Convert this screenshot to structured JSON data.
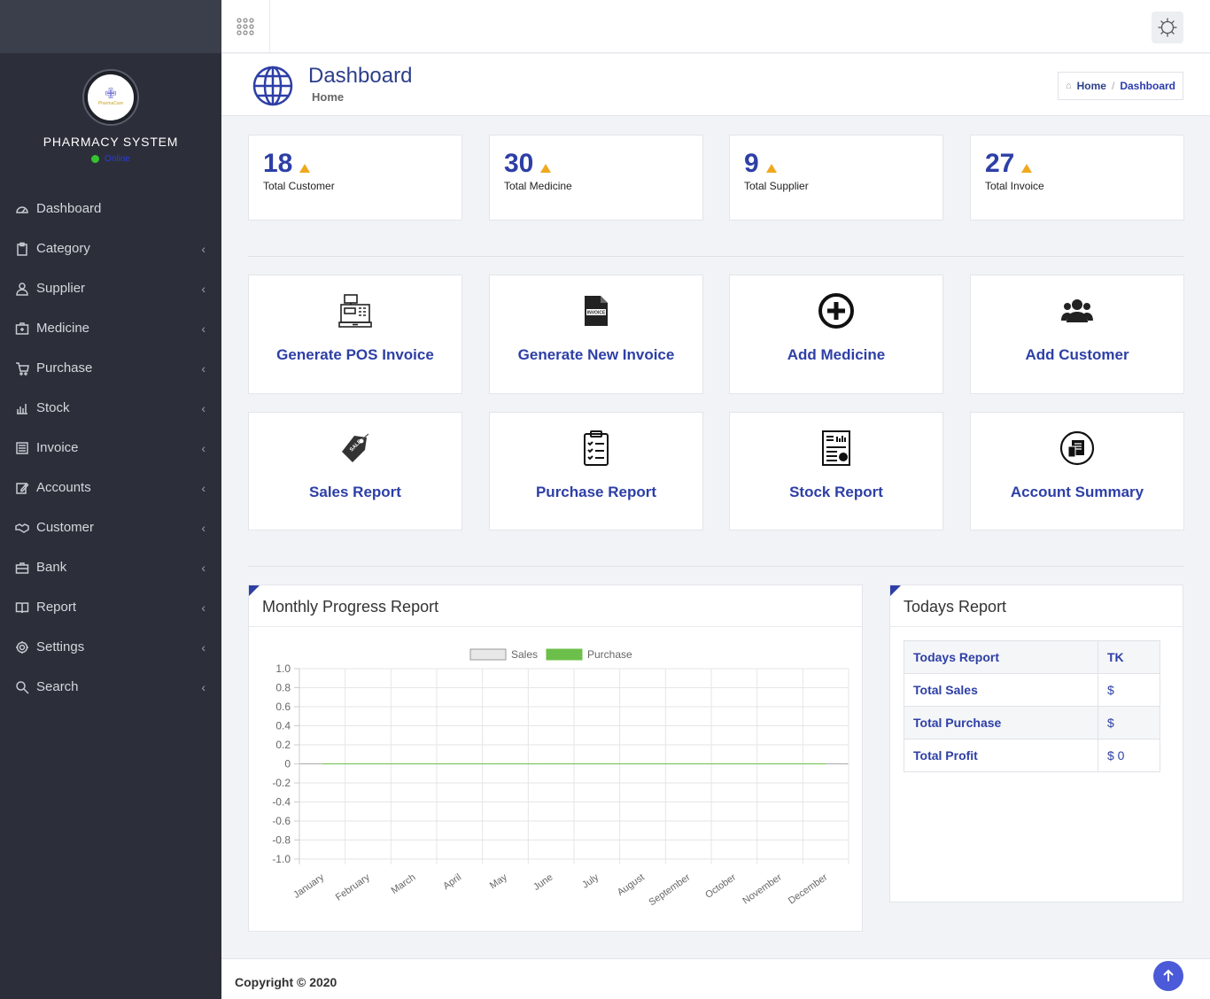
{
  "sidebar": {
    "system_name": "PHARMACY SYSTEM",
    "status": "Online",
    "logo_text": "PharmaCare",
    "items": [
      {
        "label": "Dashboard",
        "icon": "dashboard-icon",
        "chevron": ""
      },
      {
        "label": "Category",
        "icon": "clipboard-icon",
        "chevron": "‹"
      },
      {
        "label": "Supplier",
        "icon": "user-icon",
        "chevron": "‹"
      },
      {
        "label": "Medicine",
        "icon": "medkit-icon",
        "chevron": "‹"
      },
      {
        "label": "Purchase",
        "icon": "cart-icon",
        "chevron": "‹"
      },
      {
        "label": "Stock",
        "icon": "bar-chart-icon",
        "chevron": "‹"
      },
      {
        "label": "Invoice",
        "icon": "list-icon",
        "chevron": "‹"
      },
      {
        "label": "Accounts",
        "icon": "edit-icon",
        "chevron": "‹"
      },
      {
        "label": "Customer",
        "icon": "handshake-icon",
        "chevron": "‹"
      },
      {
        "label": "Bank",
        "icon": "briefcase-icon",
        "chevron": "‹"
      },
      {
        "label": "Report",
        "icon": "book-icon",
        "chevron": "‹"
      },
      {
        "label": "Settings",
        "icon": "gear-icon",
        "chevron": "‹"
      },
      {
        "label": "Search",
        "icon": "search-icon",
        "chevron": "‹"
      }
    ]
  },
  "header": {
    "title": "Dashboard",
    "subtitle": "Home",
    "breadcrumb": {
      "home": "Home",
      "separator": "/",
      "current": "Dashboard"
    }
  },
  "stats": [
    {
      "value": "18",
      "label": "Total Customer"
    },
    {
      "value": "30",
      "label": "Total Medicine"
    },
    {
      "value": "9",
      "label": "Total Supplier"
    },
    {
      "value": "27",
      "label": "Total Invoice"
    }
  ],
  "actions": [
    {
      "label": "Generate POS Invoice",
      "icon": "cash-register-icon"
    },
    {
      "label": "Generate New Invoice",
      "icon": "invoice-file-icon"
    },
    {
      "label": "Add Medicine",
      "icon": "plus-circle-icon"
    },
    {
      "label": "Add Customer",
      "icon": "users-icon"
    },
    {
      "label": "Sales Report",
      "icon": "sale-tag-icon"
    },
    {
      "label": "Purchase Report",
      "icon": "clipboard-list-icon"
    },
    {
      "label": "Stock Report",
      "icon": "stock-report-icon"
    },
    {
      "label": "Account Summary",
      "icon": "account-summary-icon"
    }
  ],
  "monthly_panel": {
    "title": "Monthly Progress Report"
  },
  "chart_data": {
    "type": "line",
    "title": "",
    "xlabel": "",
    "ylabel": "",
    "categories": [
      "January",
      "February",
      "March",
      "April",
      "May",
      "June",
      "July",
      "August",
      "September",
      "October",
      "November",
      "December"
    ],
    "series": [
      {
        "name": "Sales",
        "values": [
          0,
          0,
          0,
          0,
          0,
          0,
          0,
          0,
          0,
          0,
          0,
          0
        ],
        "color": "#e8e8e8"
      },
      {
        "name": "Purchase",
        "values": [
          0,
          0,
          0,
          0,
          0,
          0,
          0,
          0,
          0,
          0,
          0,
          0
        ],
        "color": "#6cbf4a"
      }
    ],
    "ylim": [
      -1.0,
      1.0
    ],
    "yticks": [
      "1.0",
      "0.8",
      "0.6",
      "0.4",
      "0.2",
      "0",
      "-0.2",
      "-0.4",
      "-0.6",
      "-0.8",
      "-1.0"
    ],
    "grid": true,
    "legend": "top"
  },
  "todays_panel": {
    "title": "Todays Report",
    "rows": [
      {
        "label": "Todays Report",
        "value": "TK"
      },
      {
        "label": "Total Sales",
        "value": "$"
      },
      {
        "label": "Total Purchase",
        "value": "$"
      },
      {
        "label": "Total Profit",
        "value": "$ 0"
      }
    ]
  },
  "footer": {
    "copyright": "Copyright © 2020"
  },
  "colors": {
    "accent": "#2d3fa6",
    "sidebar": "#2c2f3a",
    "triangle": "#f0a81e",
    "scroll_top": "#4a5ad8"
  }
}
